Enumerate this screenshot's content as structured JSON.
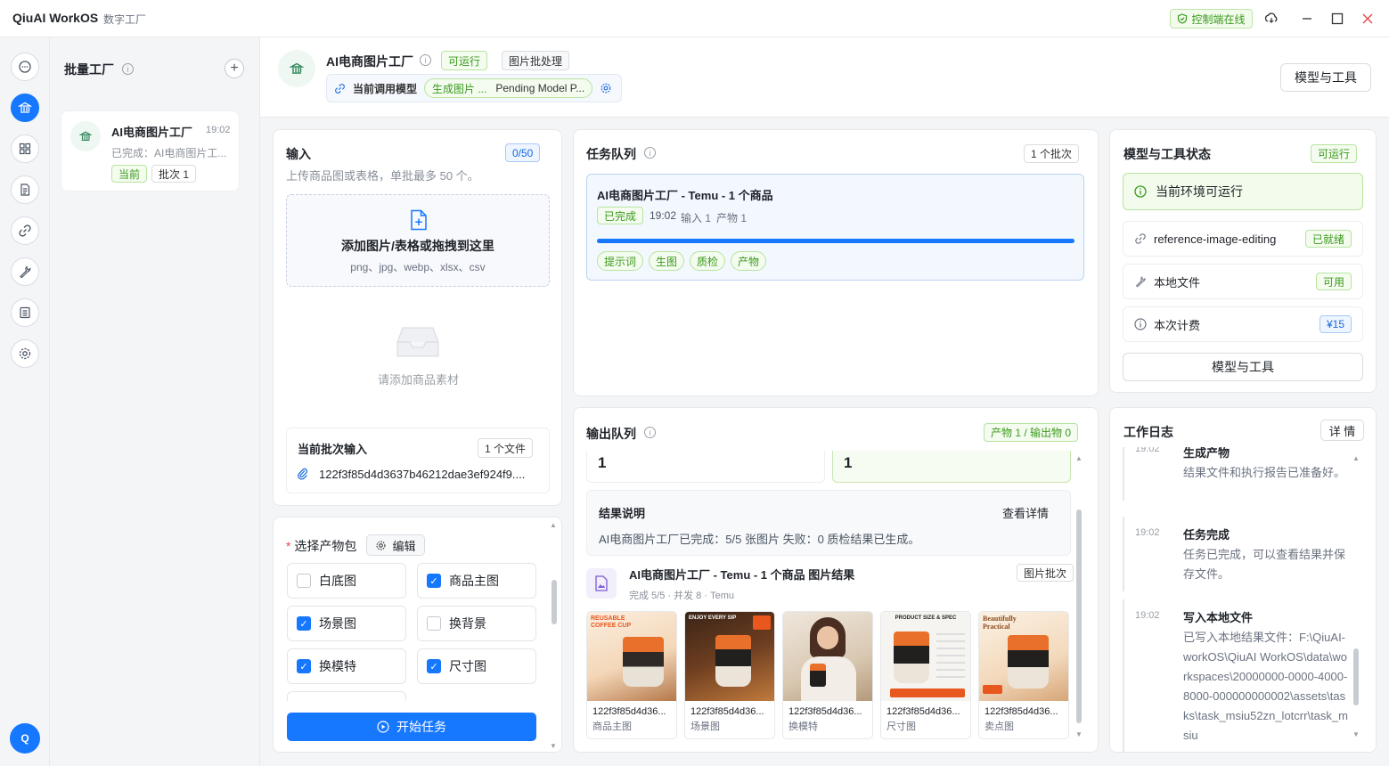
{
  "app": {
    "name": "QiuAI WorkOS",
    "subtitle": "数字工厂",
    "control_status": "控制端在线"
  },
  "sidebar": {
    "title": "批量工厂",
    "project": {
      "name": "AI电商图片工厂",
      "time": "19:02",
      "desc": "已完成：AI电商图片工...",
      "tag_current": "当前",
      "tag_batch": "批次 1"
    }
  },
  "header": {
    "title": "AI电商图片工厂",
    "status_tag": "可运行",
    "type_tag": "图片批处理",
    "model_label": "当前调用模型",
    "model_chip_a": "生成图片 ...",
    "model_chip_b": "Pending Model P...",
    "tools_button": "模型与工具"
  },
  "input": {
    "title": "输入",
    "count": "0/50",
    "hint": "上传商品图或表格，单批最多 50 个。",
    "drop_title": "添加图片/表格或拖拽到这里",
    "drop_formats": "png、jpg、webp、xlsx、csv",
    "empty_text": "请添加商品素材",
    "batch_title": "当前批次输入",
    "batch_count": "1 个文件",
    "file_name": "122f3f85d4d3637b46212dae3ef924f9...."
  },
  "products": {
    "label": "选择产物包",
    "edit": "编辑",
    "options": [
      {
        "label": "白底图",
        "checked": false
      },
      {
        "label": "商品主图",
        "checked": true
      },
      {
        "label": "场景图",
        "checked": true
      },
      {
        "label": "换背景",
        "checked": false
      },
      {
        "label": "换模特",
        "checked": true
      },
      {
        "label": "尺寸图",
        "checked": true
      }
    ],
    "start_button": "开始任务"
  },
  "tasks": {
    "title": "任务队列",
    "batch_tag": "1 个批次",
    "item": {
      "title": "AI电商图片工厂 - Temu - 1 个商品",
      "status": "已完成",
      "time": "19:02",
      "input": "输入 1",
      "output": "产物 1",
      "progress": 1.0,
      "steps": [
        "提示词",
        "生图",
        "质检",
        "产物"
      ]
    }
  },
  "output": {
    "title": "输出队列",
    "summary_tag": "产物 1 / 输出物 0",
    "stat_a": "1",
    "stat_b": "1",
    "result_title": "结果说明",
    "result_link": "查看详情",
    "result_text": "AI电商图片工厂已完成：5/5 张图片 失败：0 质检结果已生成。",
    "gallery_title": "AI电商图片工厂 - Temu - 1 个商品 图片结果",
    "gallery_tag": "图片批次",
    "gallery_meta": "完成 5/5 · 并发 8 · Temu",
    "images": [
      {
        "file": "122f3f85d4d36...",
        "caption": "商品主图",
        "overlay": "REUSABLE COFFEE CUP"
      },
      {
        "file": "122f3f85d4d36...",
        "caption": "场景图",
        "overlay": "ENJOY EVERY SIP"
      },
      {
        "file": "122f3f85d4d36...",
        "caption": "换模特",
        "overlay": ""
      },
      {
        "file": "122f3f85d4d36...",
        "caption": "尺寸图",
        "overlay": "PRODUCT SIZE & SPEC"
      },
      {
        "file": "122f3f85d4d36...",
        "caption": "卖点图",
        "overlay": "Beautifully Practical"
      }
    ]
  },
  "status": {
    "title": "模型与工具状态",
    "tag": "可运行",
    "env": "当前环境可运行",
    "rows": [
      {
        "label": "reference-image-editing",
        "tag": "已就绪"
      },
      {
        "label": "本地文件",
        "tag": "可用"
      },
      {
        "label": "本次计费",
        "tag": "¥15"
      }
    ],
    "button": "模型与工具"
  },
  "log": {
    "title": "工作日志",
    "detail_button": "详 情",
    "entries": [
      {
        "time": "19:02",
        "title": "生成产物",
        "text": "结果文件和执行报告已准备好。"
      },
      {
        "time": "19:02",
        "title": "任务完成",
        "text": "任务已完成，可以查看结果并保存文件。"
      },
      {
        "time": "19:02",
        "title": "写入本地文件",
        "text": "已写入本地结果文件：F:\\QiuAI-workOS\\QiuAI WorkOS\\data\\workspaces\\20000000-0000-4000-8000-000000000002\\assets\\tasks\\task_msiu52zn_lotcrr\\task_msiu"
      }
    ]
  },
  "colors": {
    "accent": "#1677ff",
    "success": "#3b9a1d"
  }
}
